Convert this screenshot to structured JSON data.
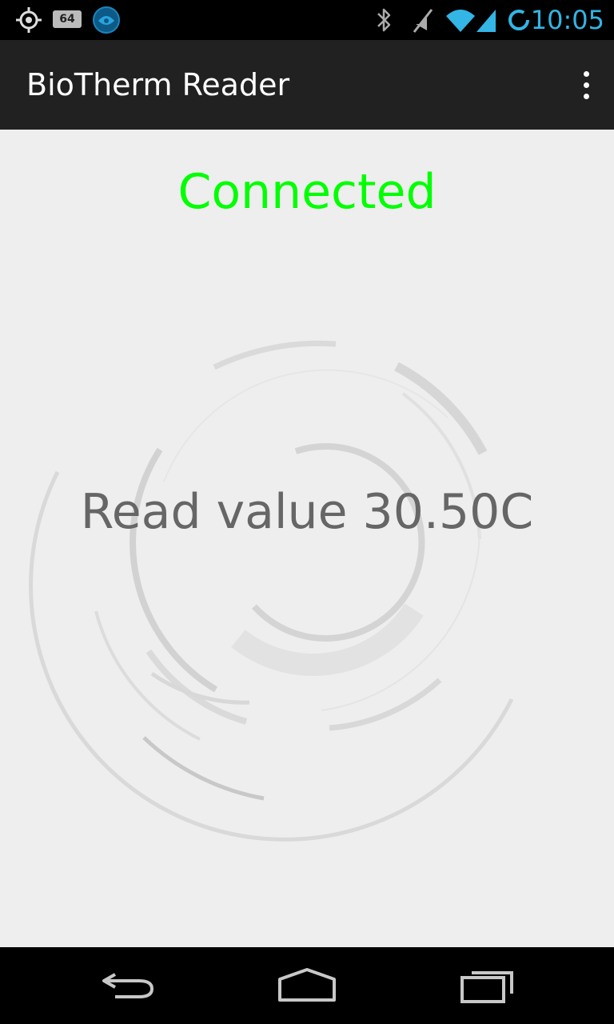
{
  "status_bar": {
    "time": "10:05",
    "battery_badge": "64",
    "icons": [
      "gps-icon",
      "battery-badge-icon",
      "app-notification-icon",
      "bluetooth-icon",
      "vibrate-off-icon",
      "wifi-icon",
      "cell-signal-icon",
      "sync-icon"
    ],
    "accent_color": "#33b5e5"
  },
  "action_bar": {
    "title": "BioTherm Reader",
    "overflow_icon": "more-vert-icon"
  },
  "main": {
    "connection_status": "Connected",
    "connection_color": "#00ff00",
    "reading": "Read value 30.50C"
  },
  "nav_bar": {
    "icons": [
      "back-icon",
      "home-icon",
      "recent-apps-icon"
    ]
  }
}
